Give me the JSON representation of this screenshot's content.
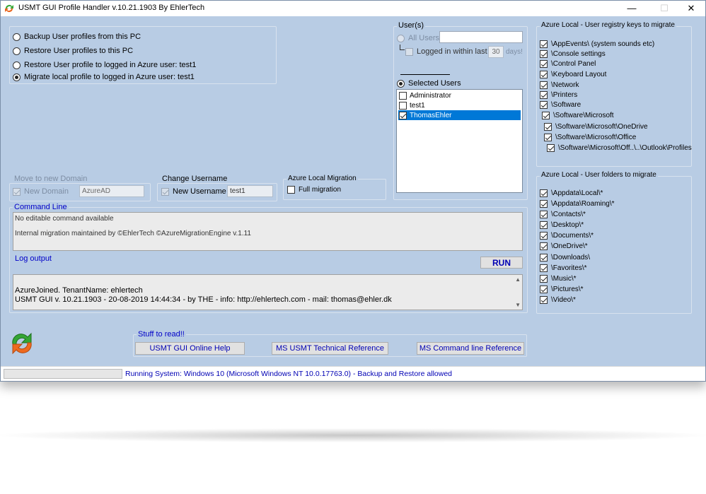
{
  "window": {
    "title": "USMT GUI Profile Handler v.10.21.1903 By EhlerTech",
    "minimize": "—",
    "maximize": "☐",
    "close": "✕"
  },
  "mode_options": [
    {
      "label": "Backup User profiles from this PC",
      "selected": false
    },
    {
      "label": "Restore User profiles to this PC",
      "selected": false
    },
    {
      "label": "Restore User profile to logged in Azure user: test1",
      "selected": false
    },
    {
      "label": "Migrate local profile to logged in Azure user: test1",
      "selected": true
    }
  ],
  "users": {
    "group_label": "User(s)",
    "all_users_label": "All Users",
    "logged_in_label": "Logged in within last",
    "days_value": "30",
    "days_label": "days!",
    "selected_users_label": "Selected Users",
    "list": [
      {
        "name": "Administrator",
        "checked": false,
        "selected": false
      },
      {
        "name": "test1",
        "checked": false,
        "selected": false
      },
      {
        "name": "ThomasEhler",
        "checked": true,
        "selected": true
      }
    ]
  },
  "domain": {
    "group_label": "Move to new Domain",
    "check_label": "New Domain",
    "value": "AzureAD"
  },
  "username": {
    "group_label": "Change Username",
    "check_label": "New Username",
    "value": "test1"
  },
  "azure_migration": {
    "group_label": "Azure Local Migration",
    "check_label": "Full migration"
  },
  "command_line": {
    "label": "Command Line",
    "line1": "No editable command available",
    "line2": "Internal migration maintained by ©EhlerTech ©AzureMigrationEngine v.1.11"
  },
  "log": {
    "label": "Log output",
    "run_label": "RUN",
    "line1": "AzureJoined. TenantName: ehlertech",
    "line2": "USMT GUI v. 10.21.1903  - 20-08-2019 14:44:34 - by THE - info: http://ehlertech.com - mail: thomas@ehler.dk"
  },
  "read": {
    "label": "Stuff to read!!",
    "btn1": "USMT GUI Online Help",
    "btn2": "MS USMT Technical Reference",
    "btn3": "MS Command line Reference"
  },
  "registry": {
    "group_label": "Azure Local - User registry keys to migrate",
    "items": [
      "\\AppEvents\\ (system sounds etc)",
      "\\Console settings",
      "\\Control Panel",
      "\\Keyboard Layout",
      "\\Network",
      "\\Printers",
      "\\Software",
      "\\Software\\Microsoft",
      "\\Software\\Microsoft\\OneDrive",
      "\\Software\\Microsoft\\Office",
      "\\Software\\Microsoft\\Off..\\..\\Outlook\\Profiles"
    ]
  },
  "folders": {
    "group_label": "Azure Local - User folders to migrate",
    "items": [
      "\\Appdata\\Local\\*",
      "\\Appdata\\Roaming\\*",
      "\\Contacts\\*",
      "\\Desktop\\*",
      "\\Documents\\*",
      "\\OneDrive\\*",
      "\\Downloads\\",
      "\\Favorites\\*",
      "\\Music\\*",
      "\\Pictures\\*",
      "\\Video\\*"
    ]
  },
  "status": {
    "text": "Running System: Windows 10  (Microsoft Windows NT 10.0.17763.0) - Backup and Restore allowed"
  }
}
